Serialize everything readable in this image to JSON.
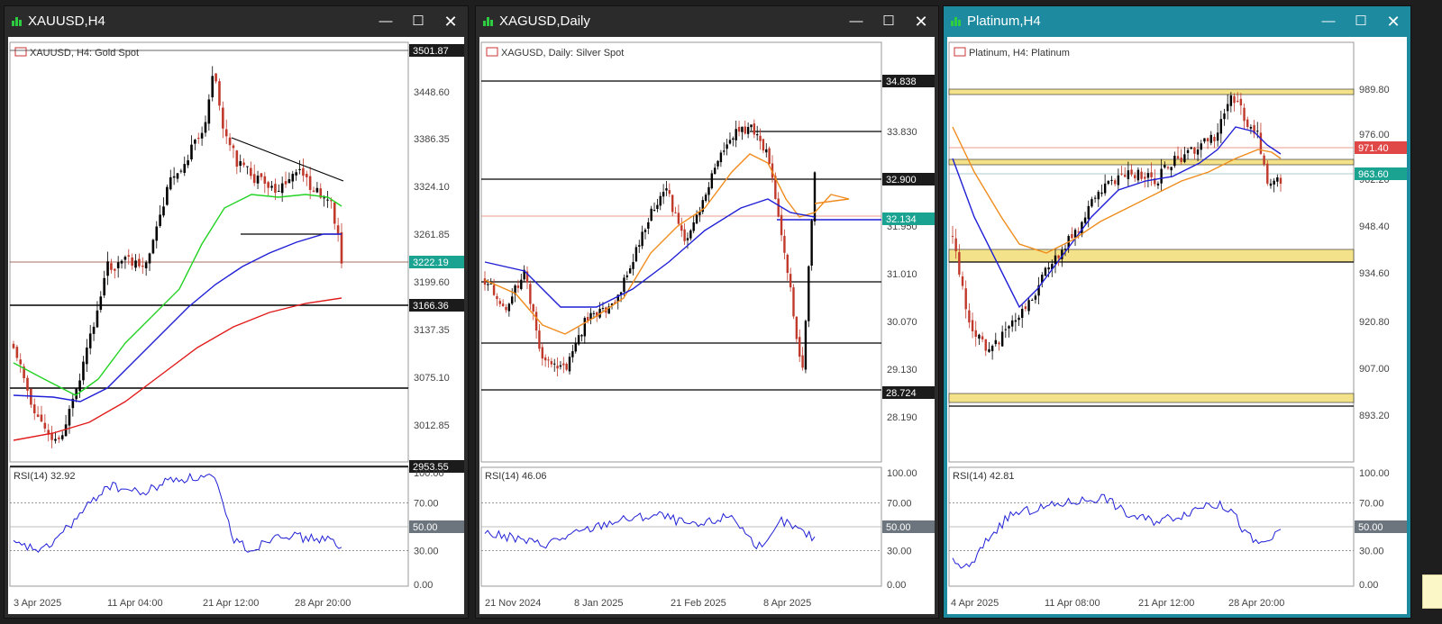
{
  "windows": [
    {
      "id": "xau",
      "title": "XAUUSD,H4",
      "label": "XAUUSD, H4:  Gold Spot",
      "active": false,
      "price_ticks": [
        "3501.87",
        "3448.60",
        "3386.35",
        "3324.10",
        "3261.85",
        "3199.60",
        "3137.35",
        "3075.10",
        "3012.85",
        "2953.55"
      ],
      "highlight_labels": [
        {
          "text": "3501.87",
          "style": "dark"
        },
        {
          "text": "3222.19",
          "style": "teal"
        },
        {
          "text": "3166.36",
          "style": "dark"
        },
        {
          "text": "2953.55",
          "style": "dark"
        }
      ],
      "time_labels": [
        "3 Apr 2025",
        "11 Apr 04:00",
        "21 Apr 12:00",
        "28 Apr 20:00"
      ],
      "rsi": {
        "label": "RSI(14) 32.92",
        "value": 32.92,
        "levels": [
          "100.00",
          "70.00",
          "50.00",
          "30.00",
          "0.00"
        ],
        "level50_box": "50.00"
      }
    },
    {
      "id": "xag",
      "title": "XAGUSD,Daily",
      "label": "XAGUSD, Daily:  Silver Spot",
      "active": false,
      "price_ticks": [
        "34.838",
        "33.830",
        "32.900",
        "31.950",
        "31.010",
        "30.070",
        "29.130",
        "28.724",
        "28.190"
      ],
      "highlight_labels": [
        {
          "text": "34.838",
          "style": "dark"
        },
        {
          "text": "32.900",
          "style": "dark"
        },
        {
          "text": "32.134",
          "style": "teal"
        },
        {
          "text": "28.724",
          "style": "dark"
        }
      ],
      "time_labels": [
        "21 Nov 2024",
        "8 Jan 2025",
        "21 Feb 2025",
        "8 Apr 2025"
      ],
      "rsi": {
        "label": "RSI(14) 46.06",
        "value": 46.06,
        "levels": [
          "100.00",
          "70.00",
          "50.00",
          "30.00",
          "0.00"
        ],
        "level50_box": "50.00"
      }
    },
    {
      "id": "xpt",
      "title": "Platinum,H4",
      "label": "Platinum, H4:  Platinum",
      "active": true,
      "price_ticks": [
        "989.80",
        "976.00",
        "962.20",
        "948.40",
        "934.60",
        "920.80",
        "907.00",
        "893.20"
      ],
      "highlight_labels": [
        {
          "text": "971.40",
          "style": "red"
        },
        {
          "text": "963.60",
          "style": "teal"
        }
      ],
      "time_labels": [
        "4 Apr 2025",
        "11 Apr 08:00",
        "21 Apr 12:00",
        "28 Apr 20:00"
      ],
      "rsi": {
        "label": "RSI(14) 42.81",
        "value": 42.81,
        "levels": [
          "100.00",
          "70.00",
          "50.00",
          "30.00",
          "0.00"
        ],
        "level50_box": "50.00"
      }
    }
  ],
  "window_buttons": {
    "minimize": "—",
    "maximize": "☐",
    "close": "✕"
  },
  "colors": {
    "active_frame": "#1d8aa0",
    "inactive_frame": "#2b2b2b",
    "bull": "#000000",
    "bear": "#c0392b",
    "ma_green": "#22d322",
    "ma_blue": "#1f1fd6",
    "ma_red": "#e11b1b",
    "ma_orange": "#f08c1e",
    "rsi": "#1f1fd6",
    "zone": "#f3e28a"
  }
}
